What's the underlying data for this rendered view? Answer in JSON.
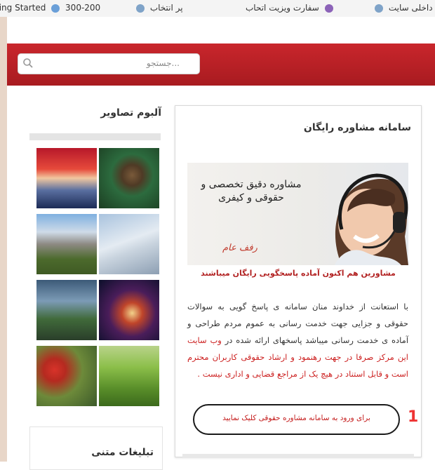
{
  "bookmarks": [
    {
      "label": "ting Started",
      "icon": "globe-icon"
    },
    {
      "label": "300-200",
      "icon": "globe-icon"
    },
    {
      "label": "پر انتخاب",
      "icon": "globe-icon"
    },
    {
      "label": "سفارت ویزیت اتحاب",
      "icon": "globe-icon"
    },
    {
      "label": "ث داخلی سایت",
      "icon": "globe-icon"
    }
  ],
  "search": {
    "placeholder": "جستجو..."
  },
  "sidebar": {
    "gallery_title": "آلبوم تصاویر",
    "ads_title": "تبلیغات متنی"
  },
  "card": {
    "title": "سامانه مشاوره رایگان",
    "banner_text": "مشاوره دقیق تخصصی و حقوقی و کیفری",
    "banner_sign": "رفف عام",
    "headline": "مشاورین هم اکنون آماده پاسخگویی رایگان میباشند",
    "paragraph_black": "با استعانت از خداوند منان سامانه ی پاسخ گویی به سوالات حقوقی و جزایی جهت خدمت رسانی به عموم مردم طراحی و آماده ی خدمت رسانی میباشد پاسخهای ارائه شده در",
    "paragraph_red": "وب سایت این مرکز صرفا در جهت رهنمود و ارشاد حقوقی کاربران محترم است و قابل استناد در هیچ یک از مراجع قضایی و اداری نیست .",
    "cta_link": "برای ورود به سامانه مشاوره حقوقی کلیک نمایید"
  },
  "annotation": {
    "number": "1"
  },
  "colors": {
    "header_red": "#c9262c",
    "link_red": "#c41a1a",
    "annotation_red": "#e33333"
  }
}
